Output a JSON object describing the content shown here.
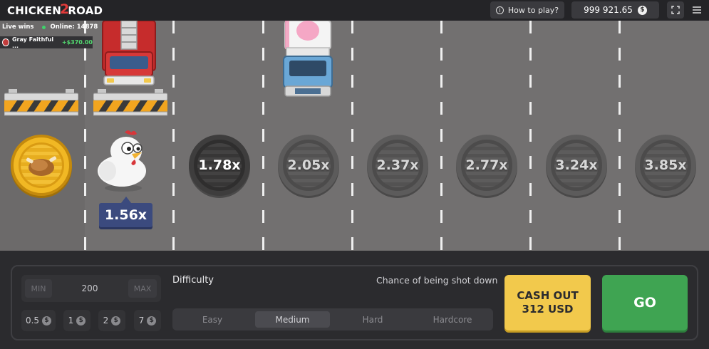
{
  "topbar": {
    "logo_part1": "CHICKEN",
    "logo_part2": "2",
    "logo_part3": "ROAD",
    "help_label": "How to play?",
    "balance": "999 921.65",
    "currency_symbol": "$"
  },
  "live_wins": {
    "title": "Live wins",
    "online": "Online: 14878",
    "entries": [
      {
        "name": "Gray Faithful ...",
        "amount": "+$370.00"
      }
    ]
  },
  "road": {
    "current_multiplier": "1.56x",
    "multipliers": [
      "1.78x",
      "2.05x",
      "2.37x",
      "2.77x",
      "3.24x",
      "3.85x"
    ]
  },
  "controls": {
    "min_label": "MIN",
    "max_label": "MAX",
    "bet_value": "200",
    "quick_bets": [
      "0.5",
      "1",
      "2",
      "7"
    ],
    "difficulty_label": "Difficulty",
    "chance_label": "Chance of being shot down",
    "difficulties": [
      "Easy",
      "Medium",
      "Hard",
      "Hardcore"
    ],
    "selected_difficulty": "Medium",
    "cashout_line1": "CASH OUT",
    "cashout_line2": "312 USD",
    "go_label": "GO"
  },
  "colors": {
    "road": "#727070",
    "cashout": "#f2c94c",
    "go": "#3fa452",
    "tag": "#3b4a7e",
    "win_green": "#52d96f"
  }
}
